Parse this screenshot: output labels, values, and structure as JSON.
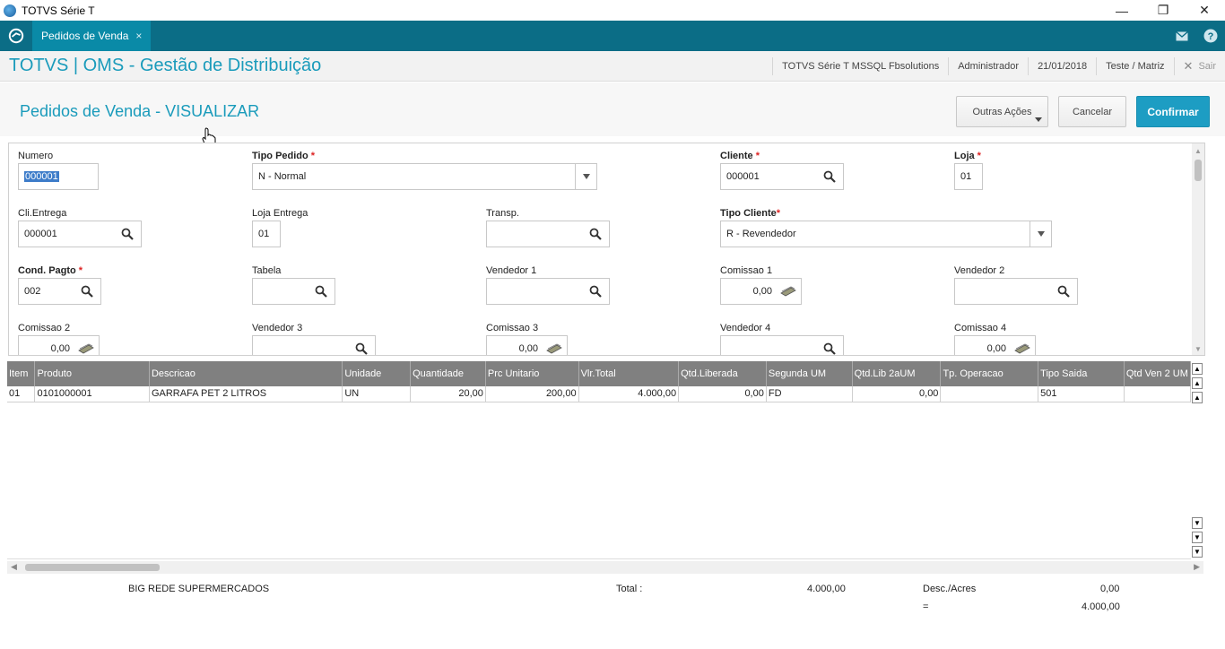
{
  "window": {
    "title": "TOTVS Série T"
  },
  "tabbar": {
    "tab_label": "Pedidos de Venda",
    "tab_close": "×"
  },
  "header": {
    "app_title": "TOTVS | OMS - Gestão de Distribuição",
    "environment": "TOTVS Série T  MSSQL Fbsolutions",
    "user": "Administrador",
    "date": "21/01/2018",
    "branch": "Teste / Matriz",
    "logout": "Sair"
  },
  "page": {
    "title": "Pedidos de Venda - VISUALIZAR",
    "btn_other": "Outras Ações",
    "btn_cancel": "Cancelar",
    "btn_confirm": "Confirmar"
  },
  "form": {
    "numero": {
      "label": "Numero",
      "value": "000001"
    },
    "tipo_pedido": {
      "label": "Tipo Pedido",
      "value": "N - Normal"
    },
    "cliente": {
      "label": "Cliente",
      "value": "000001"
    },
    "loja": {
      "label": "Loja",
      "value": "01"
    },
    "cli_entrega": {
      "label": "Cli.Entrega",
      "value": "000001"
    },
    "loja_entrega": {
      "label": "Loja Entrega",
      "value": "01"
    },
    "transp": {
      "label": "Transp.",
      "value": ""
    },
    "tipo_cliente": {
      "label": "Tipo Cliente",
      "value": "R - Revendedor"
    },
    "cond_pagto": {
      "label": "Cond. Pagto",
      "value": "002"
    },
    "tabela": {
      "label": "Tabela",
      "value": ""
    },
    "vendedor1": {
      "label": "Vendedor 1",
      "value": ""
    },
    "comissao1": {
      "label": "Comissao 1",
      "value": "0,00"
    },
    "vendedor2": {
      "label": "Vendedor 2",
      "value": ""
    },
    "comissao2": {
      "label": "Comissao 2",
      "value": "0,00"
    },
    "vendedor3": {
      "label": "Vendedor 3",
      "value": ""
    },
    "comissao3": {
      "label": "Comissao 3",
      "value": "0,00"
    },
    "vendedor4": {
      "label": "Vendedor 4",
      "value": ""
    },
    "comissao4": {
      "label": "Comissao 4",
      "value": "0,00"
    },
    "required_mark": "*"
  },
  "grid": {
    "columns": [
      "Item",
      "Produto",
      "Descricao",
      "Unidade",
      "Quantidade",
      "Prc Unitario",
      "Vlr.Total",
      "Qtd.Liberada",
      "Segunda UM",
      "Qtd.Lib 2aUM",
      "Tp. Operacao",
      "Tipo Saida",
      "Qtd Ven 2 UM"
    ],
    "rows": [
      [
        "01",
        "0101000001",
        "GARRAFA PET 2 LITROS",
        "UN",
        "20,00",
        "200,00",
        "4.000,00",
        "0,00",
        "FD",
        "0,00",
        "",
        "501",
        ""
      ]
    ]
  },
  "footer": {
    "client_name": "BIG REDE SUPERMERCADOS",
    "total_label": "Total :",
    "total_value": "4.000,00",
    "desc_label": "Desc./Acres",
    "desc_value": "0,00",
    "eq_label": "=",
    "eq_value": "4.000,00"
  },
  "colors": {
    "teal": "#0b6d86",
    "accent": "#1a9bbb",
    "confirm": "#1d9dc3"
  }
}
